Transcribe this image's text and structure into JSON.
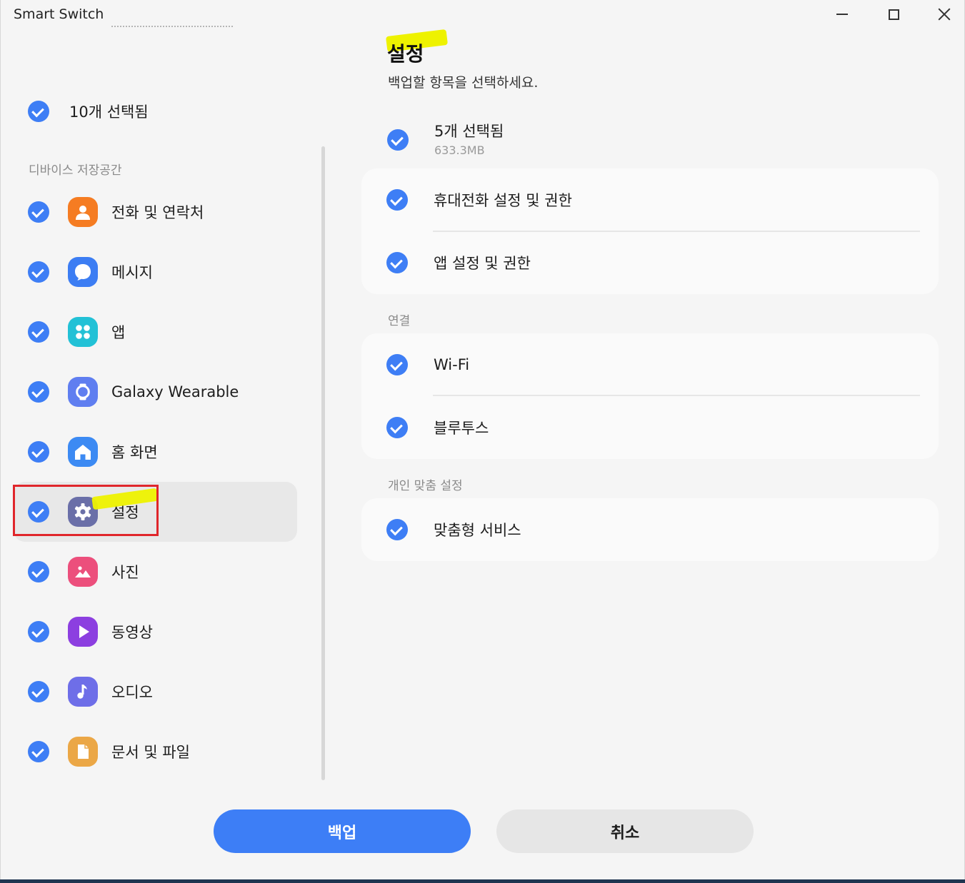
{
  "window": {
    "title": "Smart Switch"
  },
  "left": {
    "all_label": "10개 선택됨",
    "section_label": "디바이스 저장공간",
    "categories": [
      {
        "label": "전화 및 연락처",
        "icon": "contact-icon",
        "color": "#f57c22"
      },
      {
        "label": "메시지",
        "icon": "message-icon",
        "color": "#3c7df3"
      },
      {
        "label": "앱",
        "icon": "apps-icon",
        "color": "#22c1d6"
      },
      {
        "label": "Galaxy Wearable",
        "icon": "watch-icon",
        "color": "#5f7ef0"
      },
      {
        "label": "홈 화면",
        "icon": "home-icon",
        "color": "#3c8af3"
      },
      {
        "label": "설정",
        "icon": "gear-icon",
        "color": "#6a6fa8",
        "selected": true
      },
      {
        "label": "사진",
        "icon": "photo-icon",
        "color": "#ec4f7c"
      },
      {
        "label": "동영상",
        "icon": "video-icon",
        "color": "#8c3fe0"
      },
      {
        "label": "오디오",
        "icon": "music-icon",
        "color": "#6e6ee8"
      },
      {
        "label": "문서 및 파일",
        "icon": "document-icon",
        "color": "#eba746"
      }
    ]
  },
  "right": {
    "title": "설정",
    "subtitle": "백업할 항목을 선택하세요.",
    "all_label": "5개 선택됨",
    "all_size": "633.3MB",
    "group1": {
      "items": [
        "휴대전화 설정 및 권한",
        "앱 설정 및 권한"
      ]
    },
    "group2": {
      "header": "연결",
      "items": [
        "Wi-Fi",
        "블루투스"
      ]
    },
    "group3": {
      "header": "개인 맞춤 설정",
      "items": [
        "맞춤형 서비스"
      ]
    }
  },
  "buttons": {
    "backup": "백업",
    "cancel": "취소"
  },
  "colors": {
    "accent": "#3d7ef6",
    "annotation_highlight": "#eef200",
    "annotation_box": "#e0262b"
  }
}
